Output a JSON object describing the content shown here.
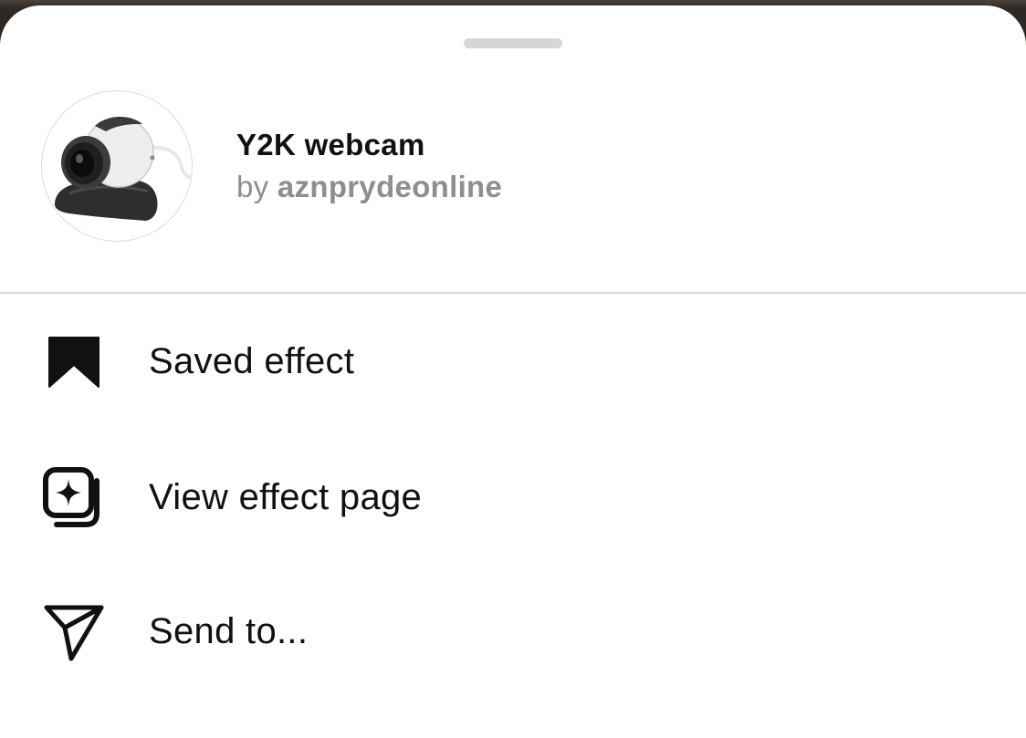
{
  "sheet": {
    "effect": {
      "name": "Y2K webcam",
      "by_prefix": "by",
      "author": "aznprydeonline",
      "thumbnail_icon": "webcam-thumbnail"
    },
    "menu": [
      {
        "label": "Saved effect",
        "icon": "bookmark-filled-icon"
      },
      {
        "label": "View effect page",
        "icon": "effect-page-icon"
      },
      {
        "label": "Send to...",
        "icon": "paper-plane-icon"
      }
    ]
  },
  "colors": {
    "background": "#ffffff",
    "text_primary": "#111111",
    "text_secondary": "#8e8e8e",
    "divider": "#dcdcdc",
    "grabber": "#d6d6d6"
  }
}
